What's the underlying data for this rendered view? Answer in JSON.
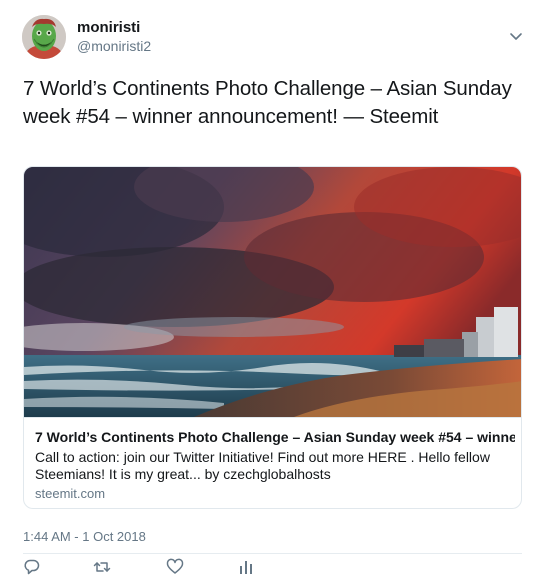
{
  "user": {
    "display_name": "moniristi",
    "handle": "@moniristi2",
    "avatar_icon": "avatar-face"
  },
  "tweet": {
    "text": "7 World’s Continents Photo Challenge – Asian Sunday week #54 – winner announcement! — Steemit",
    "timestamp": "1:44 AM - 1 Oct 2018"
  },
  "card": {
    "title": "7 World’s Continents Photo Challenge – Asian Sunday week #54 – winne...",
    "description": "Call to action: join our Twitter Initiative! Find out more HERE . Hello fellow Steemians! It is my great... by czechglobalhosts",
    "domain": "steemit.com",
    "image": "stormy-sky-beach-photo"
  },
  "actions": [
    {
      "name": "reply",
      "icon": "reply-icon"
    },
    {
      "name": "retweet",
      "icon": "retweet-icon"
    },
    {
      "name": "like",
      "icon": "heart-icon"
    },
    {
      "name": "analytics",
      "icon": "analytics-icon"
    }
  ],
  "colors": {
    "text": "#14171a",
    "secondary": "#657786",
    "border": "#e1e8ed",
    "icon": "#657786"
  }
}
